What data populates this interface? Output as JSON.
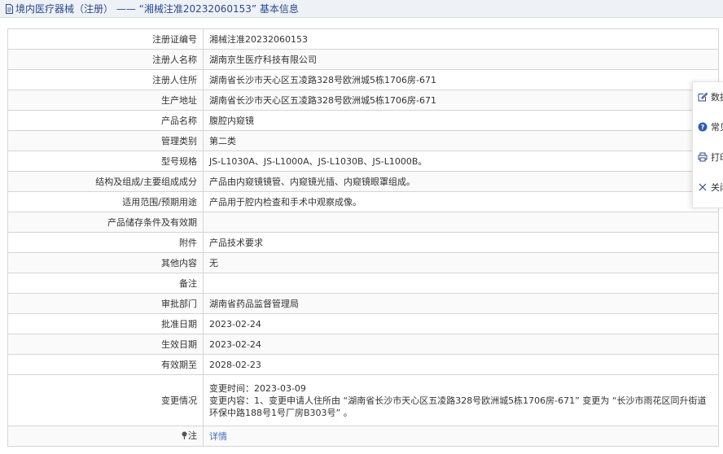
{
  "header": {
    "breadcrumb": "境内医疗器械（注册）",
    "separator": "——",
    "title": "“湘械注准20232060153” 基本信息"
  },
  "rows": [
    {
      "label": "注册证编号",
      "value": "湘械注准20232060153"
    },
    {
      "label": "注册人名称",
      "value": "湖南京生医疗科技有限公司"
    },
    {
      "label": "注册人住所",
      "value": "湖南省长沙市天心区五凌路328号欧洲城5栋1706房-671"
    },
    {
      "label": "生产地址",
      "value": "湖南省长沙市天心区五凌路328号欧洲城5栋1706房-671"
    },
    {
      "label": "产品名称",
      "value": "腹腔内窥镜"
    },
    {
      "label": "管理类别",
      "value": "第二类"
    },
    {
      "label": "型号规格",
      "value": "JS-L1030A、JS-L1000A、JS-L1030B、JS-L1000B。"
    },
    {
      "label": "结构及组成/主要组成成分",
      "value": "产品由内窥镜镜管、内窥镜光插、内窥镜眼罩组成。"
    },
    {
      "label": "适用范围/预期用途",
      "value": "产品用于腔内检查和手术中观察成像。"
    },
    {
      "label": "产品储存条件及有效期",
      "value": ""
    },
    {
      "label": "附件",
      "value": "产品技术要求"
    },
    {
      "label": "其他内容",
      "value": "无"
    },
    {
      "label": "备注",
      "value": ""
    },
    {
      "label": "审批部门",
      "value": "湖南省药品监督管理局"
    },
    {
      "label": "批准日期",
      "value": "2023-02-24"
    },
    {
      "label": "生效日期",
      "value": "2023-02-24"
    },
    {
      "label": "有效期至",
      "value": "2028-02-23"
    }
  ],
  "change": {
    "label": "变更情况",
    "time_line": "变更时间：2023-03-09",
    "content_line": "变更内容：1、变更申请人住所由 “湖南省长沙市天心区五凌路328号欧洲城5栋1706房-671” 变更为 “长沙市雨花区同升街道环保中路188号1号厂房B303号” 。"
  },
  "note": {
    "label": "注",
    "link": "详情"
  },
  "float_panel": {
    "items": [
      {
        "icon": "edit-icon",
        "label": "数据"
      },
      {
        "icon": "help-icon",
        "label": "常见"
      },
      {
        "icon": "printer-icon",
        "label": "打印"
      },
      {
        "icon": "close-icon",
        "label": "关闭"
      }
    ]
  },
  "colors": {
    "header_bg": "#eef1f6",
    "header_text": "#2a4a8a",
    "link": "#3a6fc4",
    "border": "#d5d5d5"
  }
}
